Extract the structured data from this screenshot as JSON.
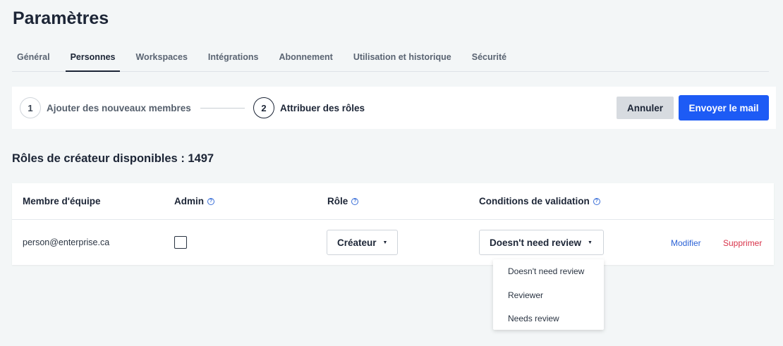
{
  "page": {
    "title": "Paramètres"
  },
  "tabs": [
    {
      "label": "Général"
    },
    {
      "label": "Personnes"
    },
    {
      "label": "Workspaces"
    },
    {
      "label": "Intégrations"
    },
    {
      "label": "Abonnement"
    },
    {
      "label": "Utilisation et historique"
    },
    {
      "label": "Sécurité"
    }
  ],
  "active_tab": "Personnes",
  "stepper": {
    "steps": [
      {
        "number": "1",
        "label": "Ajouter des nouveaux membres"
      },
      {
        "number": "2",
        "label": "Attribuer des rôles"
      }
    ],
    "cancel_label": "Annuler",
    "send_label": "Envoyer le mail"
  },
  "roles_heading": "Rôles de créateur disponibles : 1497",
  "table": {
    "headers": {
      "member": "Membre d'équipe",
      "admin": "Admin",
      "role": "Rôle",
      "validation": "Conditions de validation"
    },
    "rows": [
      {
        "email": "person@enterprise.ca",
        "admin_checked": false,
        "role": "Créateur",
        "validation": "Doesn't need review",
        "edit_label": "Modifier",
        "delete_label": "Supprimer"
      }
    ]
  },
  "validation_dropdown": {
    "options": [
      "Doesn't need review",
      "Reviewer",
      "Needs review"
    ]
  },
  "colors": {
    "primary": "#1d5bf5",
    "danger": "#d8334a",
    "link": "#2b62d6",
    "background": "#f3f6f7"
  },
  "icons": {
    "help": "question-circle-icon",
    "caret": "caret-down-icon"
  }
}
